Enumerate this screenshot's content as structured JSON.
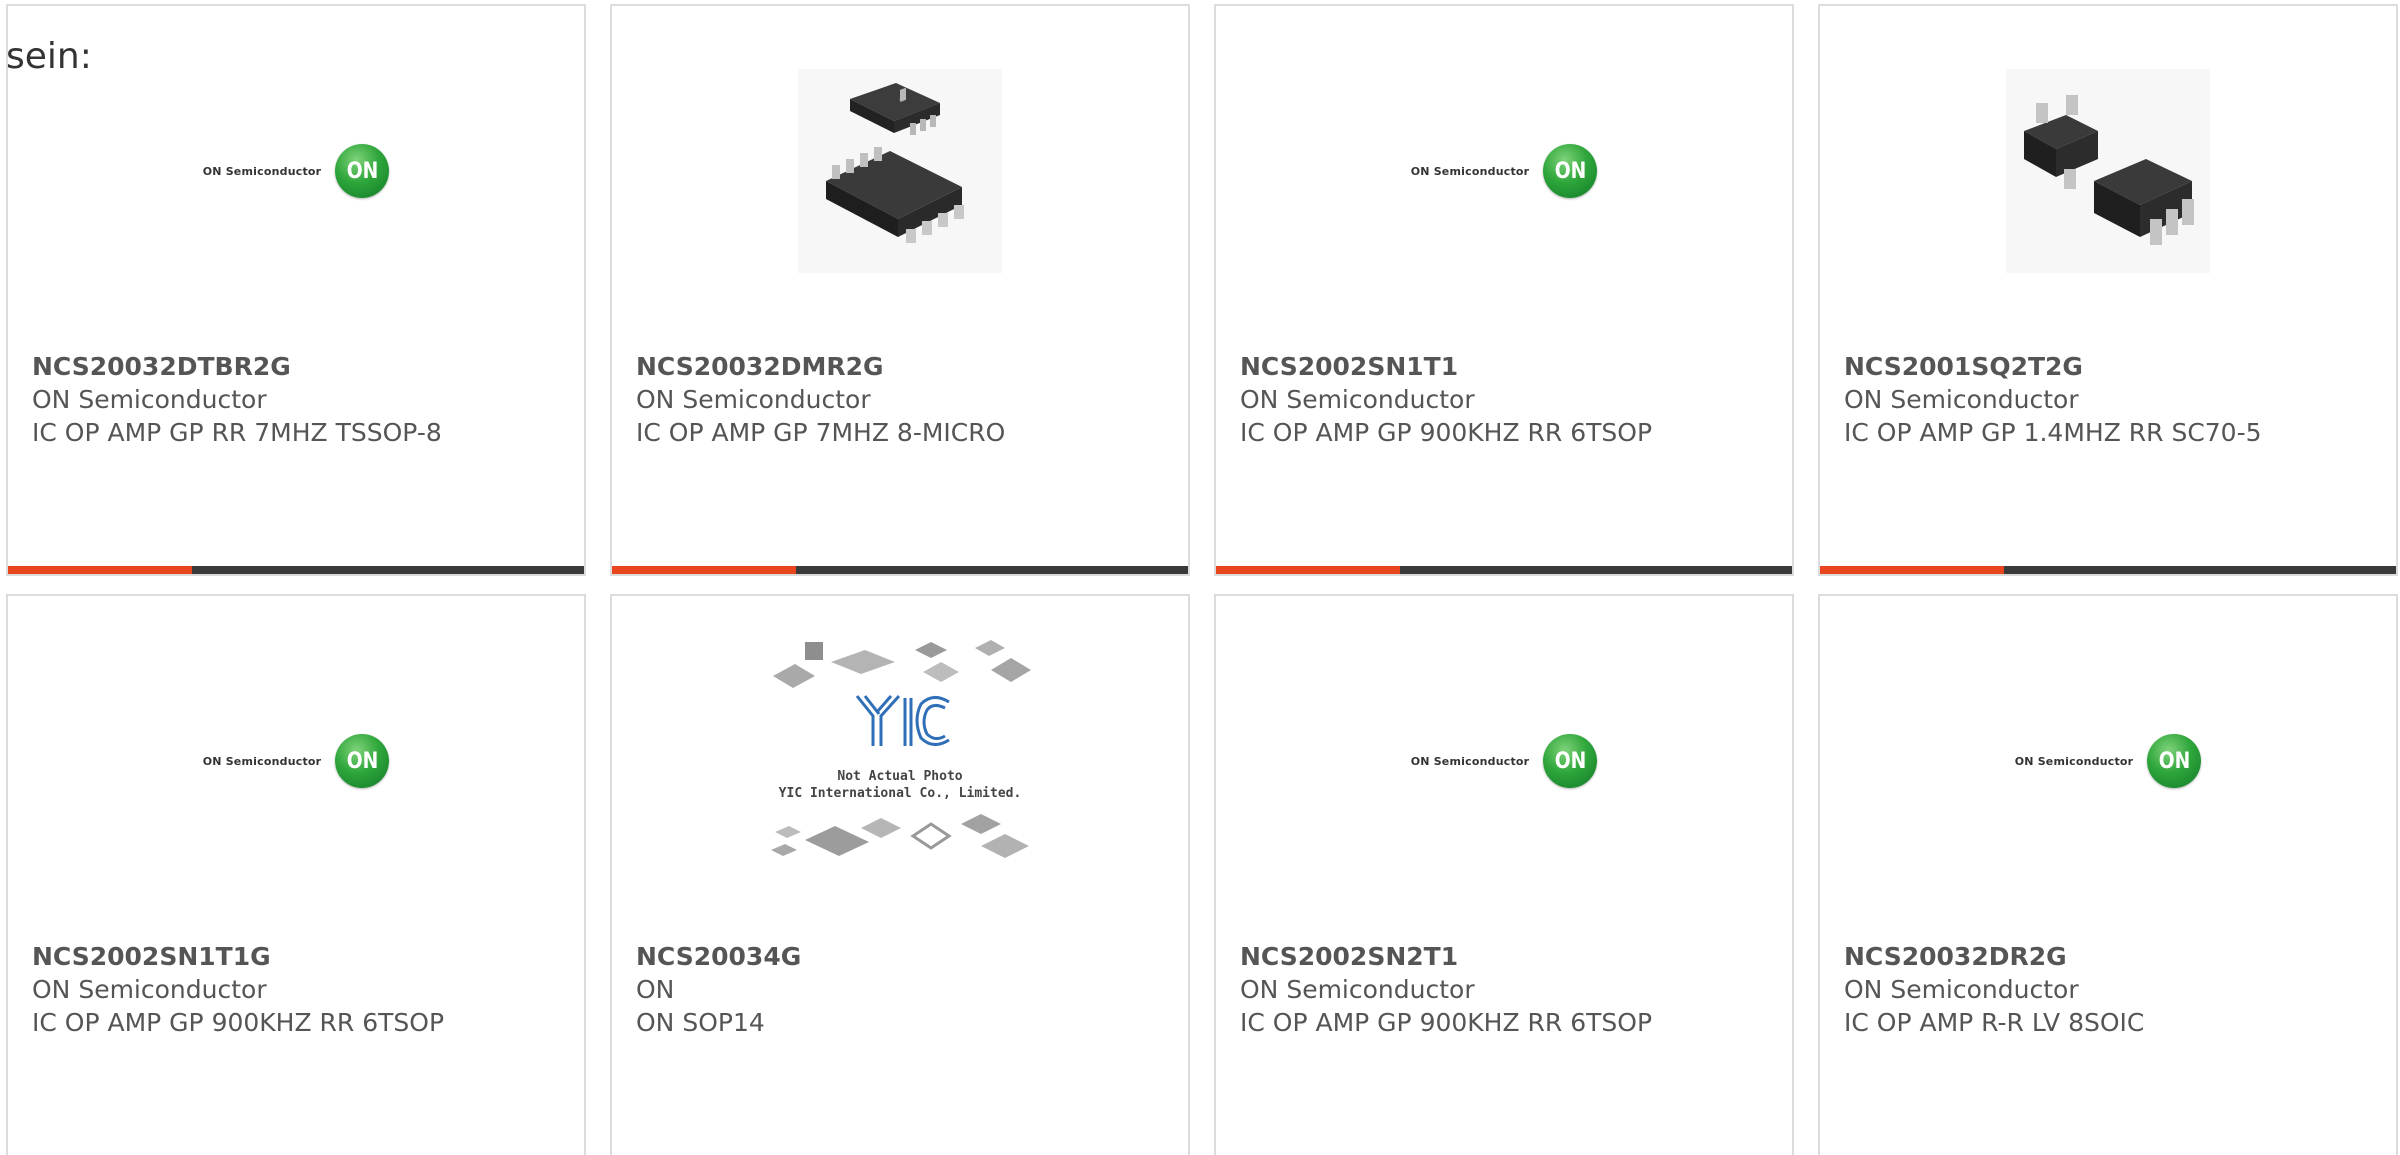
{
  "intro_text": "sein:",
  "colors": {
    "accent_bar": "#e8461e",
    "bar_base": "#3a3a3a",
    "border": "#dcdcdc",
    "on_green": "#2ea63b"
  },
  "on_logo": {
    "company": "ON Semiconductor",
    "badge": "ON"
  },
  "yic_photo": {
    "logo": "YIC",
    "line1": "Not Actual Photo",
    "line2": "YIC International Co., Limited."
  },
  "products": [
    {
      "part_no": "NCS20032DTBR2G",
      "manufacturer": "ON Semiconductor",
      "description": "IC OP AMP GP RR 7MHZ TSSOP-8",
      "image": "on-semiconductor-logo"
    },
    {
      "part_no": "NCS20032DMR2G",
      "manufacturer": "ON Semiconductor",
      "description": "IC OP AMP GP 7MHZ 8-MICRO",
      "image": "msop8-package-photo"
    },
    {
      "part_no": "NCS2002SN1T1",
      "manufacturer": "ON Semiconductor",
      "description": "IC OP AMP GP 900KHZ RR 6TSOP",
      "image": "on-semiconductor-logo"
    },
    {
      "part_no": "NCS2001SQ2T2G",
      "manufacturer": "ON Semiconductor",
      "description": "IC OP AMP GP 1.4MHZ RR SC70-5",
      "image": "sc70-package-photo"
    },
    {
      "part_no": "NCS2002SN1T1G",
      "manufacturer": "ON Semiconductor",
      "description": "IC OP AMP GP 900KHZ RR 6TSOP",
      "image": "on-semiconductor-logo"
    },
    {
      "part_no": "NCS20034G",
      "manufacturer": "ON",
      "description": "ON SOP14",
      "image": "yic-not-actual-photo"
    },
    {
      "part_no": "NCS2002SN2T1",
      "manufacturer": "ON Semiconductor",
      "description": "IC OP AMP GP 900KHZ RR 6TSOP",
      "image": "on-semiconductor-logo"
    },
    {
      "part_no": "NCS20032DR2G",
      "manufacturer": "ON Semiconductor",
      "description": "IC OP AMP R-R LV 8SOIC",
      "image": "on-semiconductor-logo"
    }
  ]
}
